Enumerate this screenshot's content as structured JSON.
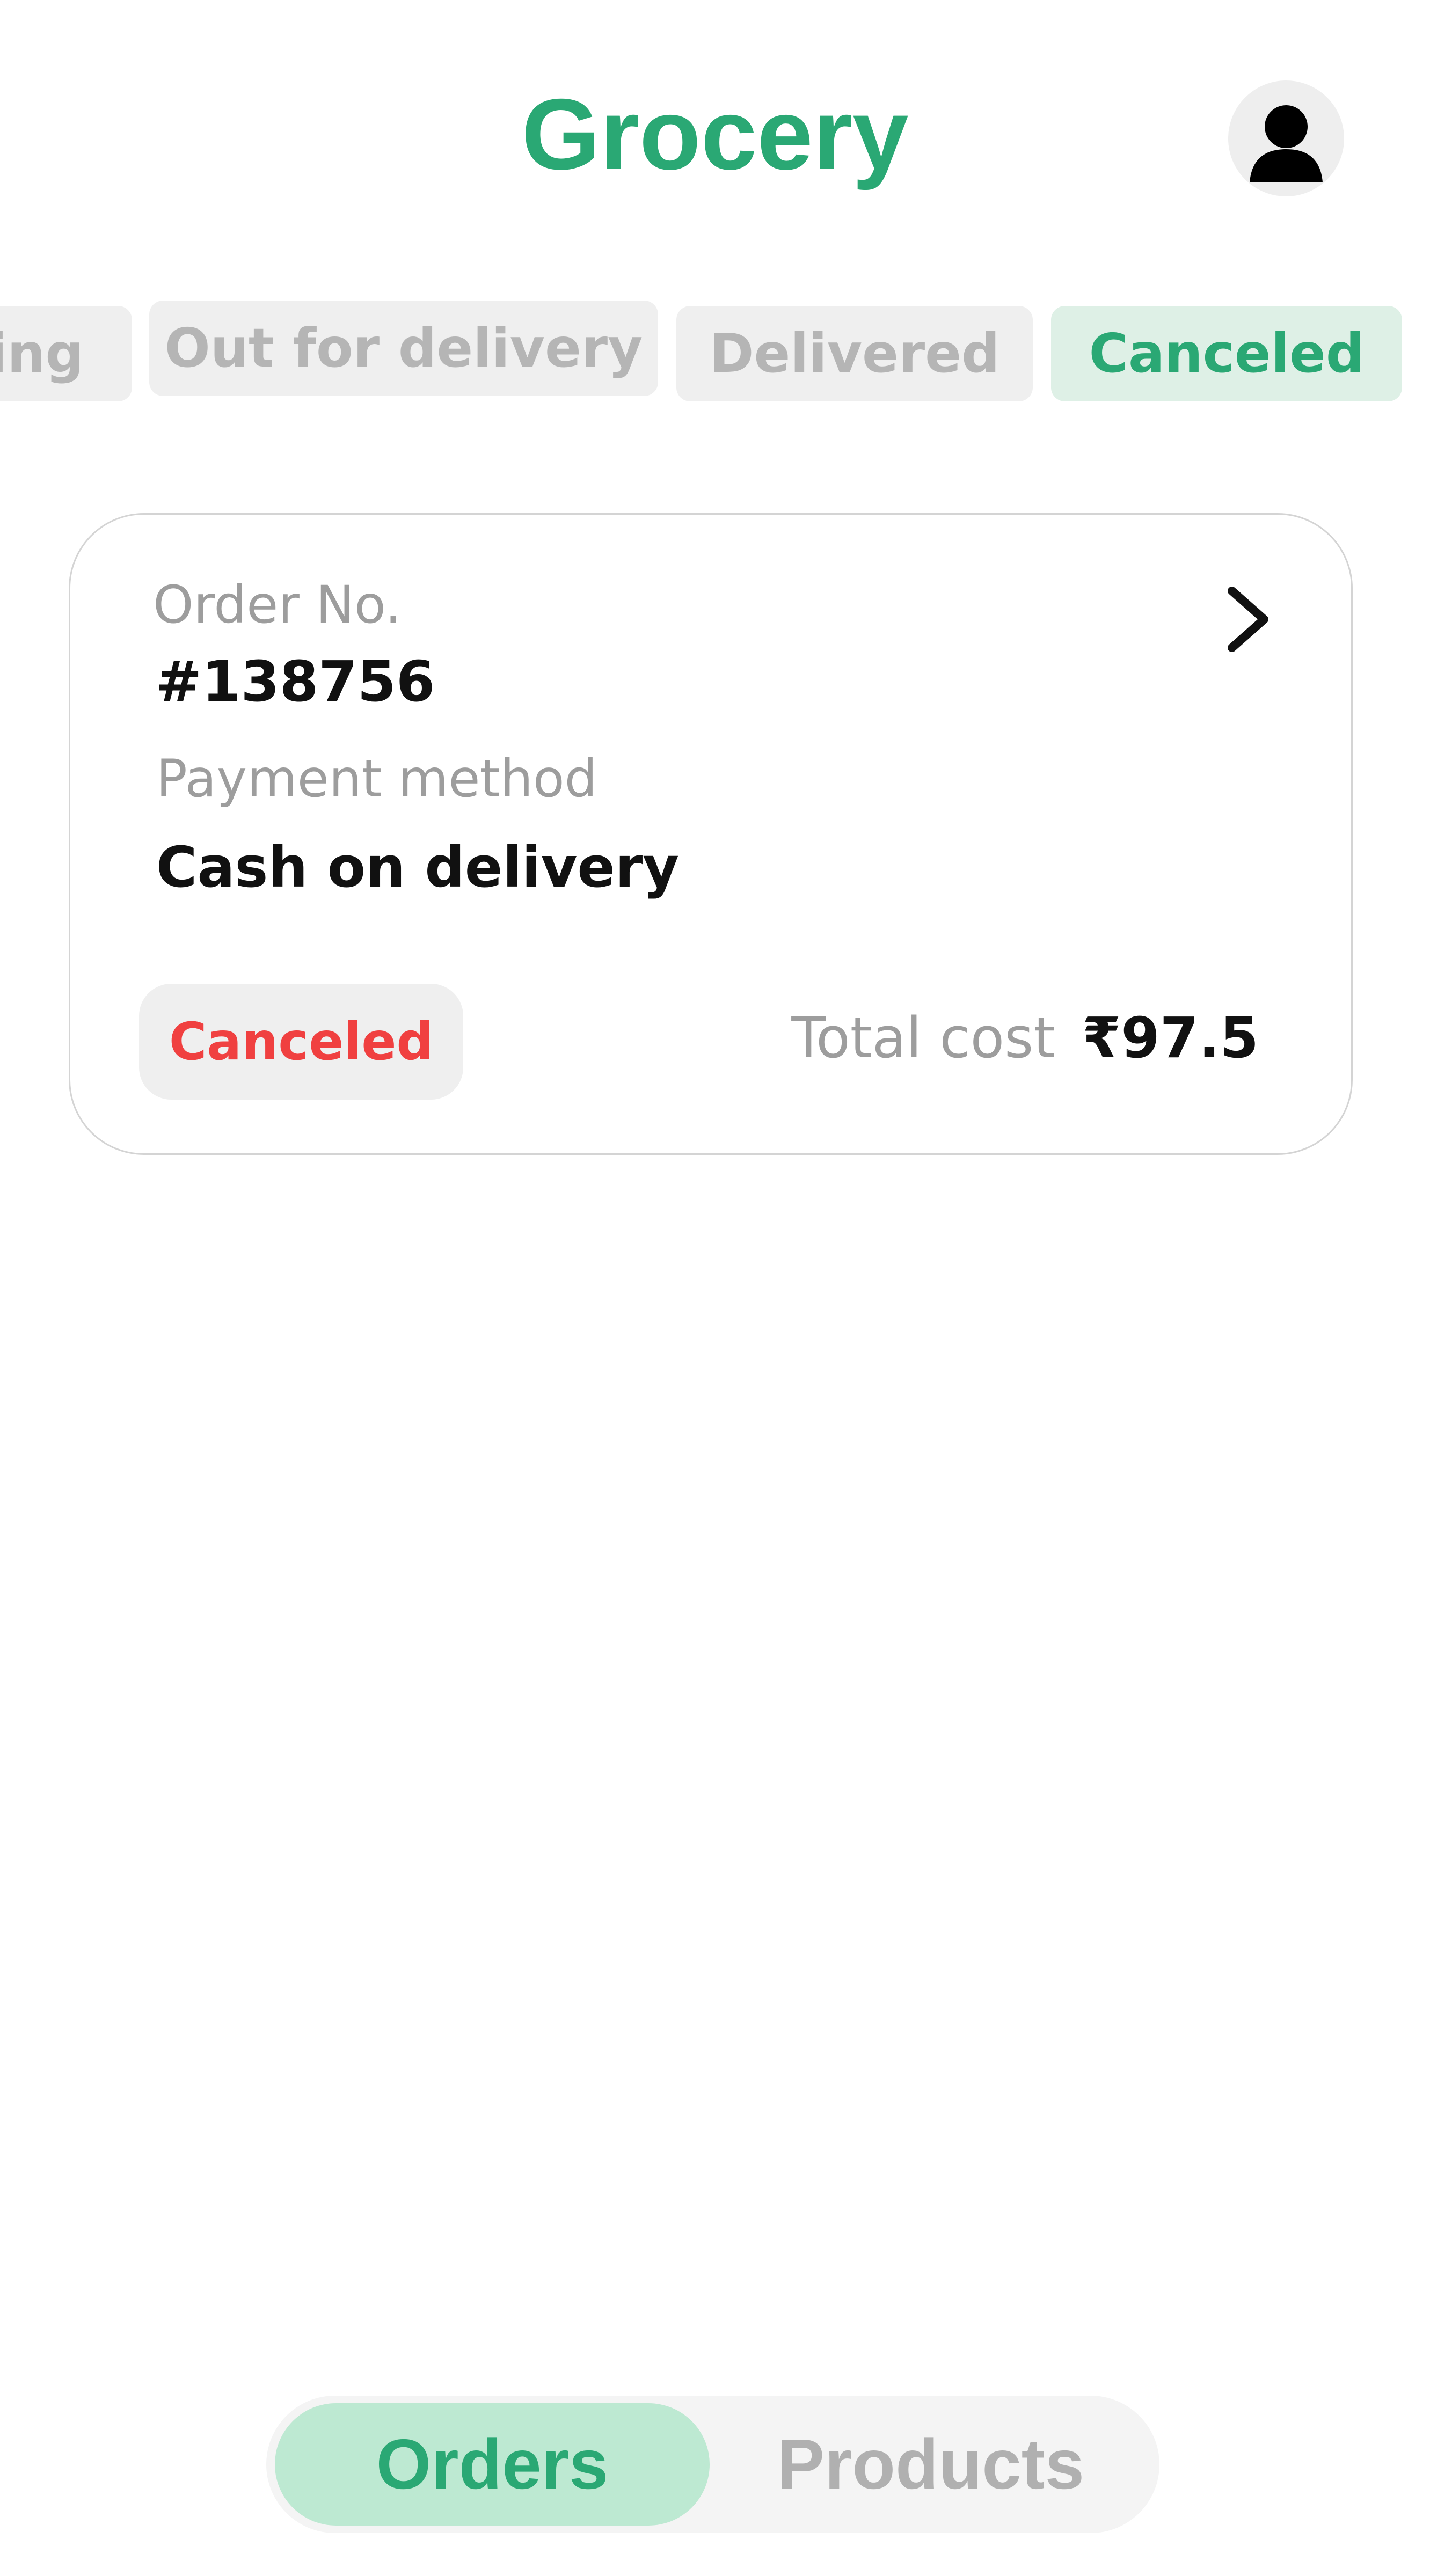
{
  "header": {
    "title": "Grocery",
    "avatar_icon": "user-silhouette-icon"
  },
  "status_tabs": [
    {
      "label": "Processing",
      "visible_text": "ing",
      "active": false
    },
    {
      "label": "Out for delivery",
      "active": false
    },
    {
      "label": "Delivered",
      "active": false
    },
    {
      "label": "Canceled",
      "active": true
    }
  ],
  "order": {
    "order_no_label": "Order No.",
    "order_no": "#138756",
    "payment_label": "Payment method",
    "payment_method": "Cash on delivery",
    "status": "Canceled",
    "total_label": "Total cost",
    "total_value": "₹97.5",
    "detail_icon": "chevron-right-icon"
  },
  "bottom_nav": {
    "orders_label": "Orders",
    "products_label": "Products",
    "active": "Orders"
  },
  "colors": {
    "brand_green": "#2aa874",
    "active_tab_bg": "#def0e6",
    "canceled_red": "#f04040",
    "nav_active_bg": "#bde9d2"
  }
}
